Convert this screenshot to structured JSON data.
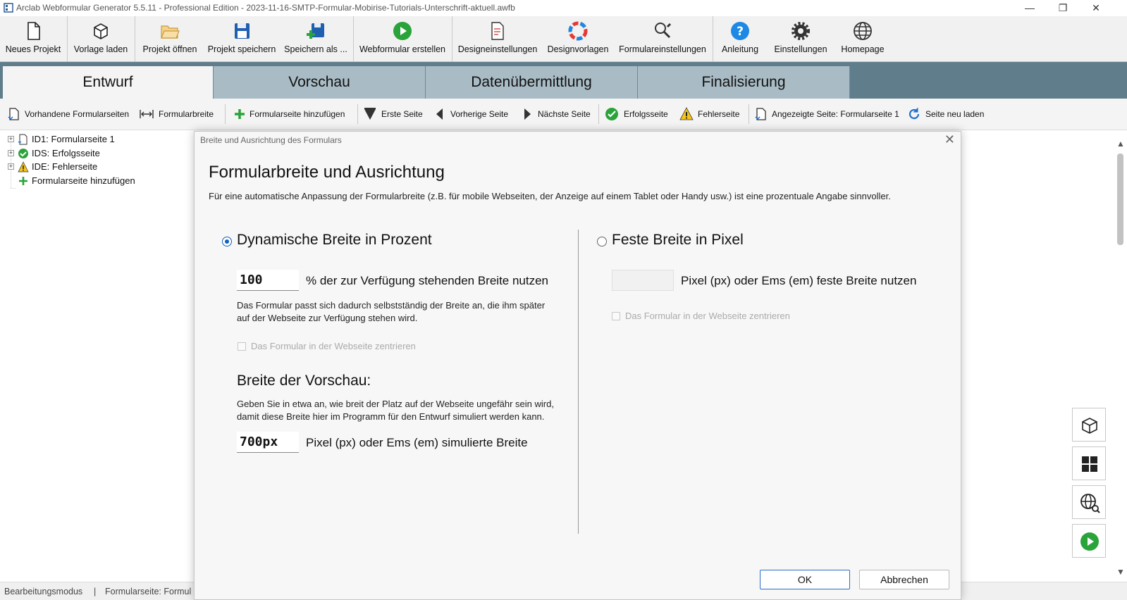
{
  "window": {
    "title": "Arclab Webformular Generator 5.5.11 - Professional Edition - 2023-11-16-SMTP-Formular-Mobirise-Tutorials-Unterschrift-aktuell.awfb",
    "minimize": "—",
    "restore": "❐",
    "close": "✕"
  },
  "toolbar": {
    "items": [
      {
        "label": "Neues Projekt",
        "icon": "new-document-icon"
      },
      {
        "label": "Vorlage laden",
        "icon": "template-box-icon"
      },
      {
        "label": "Projekt öffnen",
        "icon": "folder-open-icon"
      },
      {
        "label": "Projekt speichern",
        "icon": "floppy-disk-icon"
      },
      {
        "label": "Speichern als ...",
        "icon": "save-as-icon"
      },
      {
        "label": "Webformular erstellen",
        "icon": "play-green-icon"
      },
      {
        "label": "Designeinstellungen",
        "icon": "design-document-icon"
      },
      {
        "label": "Designvorlagen",
        "icon": "color-wheel-icon"
      },
      {
        "label": "Formulareinstellungen",
        "icon": "tools-wrench-icon"
      },
      {
        "label": "Anleitung",
        "icon": "help-icon"
      },
      {
        "label": "Einstellungen",
        "icon": "gear-icon"
      },
      {
        "label": "Homepage",
        "icon": "globe-icon"
      }
    ]
  },
  "tabs": [
    {
      "label": "Entwurf",
      "active": true
    },
    {
      "label": "Vorschau",
      "active": false
    },
    {
      "label": "Datenübermittlung",
      "active": false
    },
    {
      "label": "Finalisierung",
      "active": false
    }
  ],
  "subtoolbar": {
    "items": [
      {
        "label": "Vorhandene Formularseiten",
        "icon": "pages-icon"
      },
      {
        "label": "Formularbreite",
        "icon": "width-arrows-icon"
      },
      {
        "label": "Formularseite hinzufügen",
        "icon": "plus-icon"
      },
      {
        "label": "Erste Seite",
        "icon": "first-page-icon"
      },
      {
        "label": "Vorherige Seite",
        "icon": "previous-page-icon"
      },
      {
        "label": "Nächste Seite",
        "icon": "next-page-icon"
      },
      {
        "label": "Erfolgsseite",
        "icon": "success-check-icon"
      },
      {
        "label": "Fehlerseite",
        "icon": "warning-icon"
      },
      {
        "label": "Angezeigte Seite: Formularseite 1",
        "icon": "current-page-icon"
      },
      {
        "label": "Seite neu laden",
        "icon": "reload-icon"
      }
    ]
  },
  "tree": {
    "items": [
      {
        "label": "ID1: Formularseite 1",
        "expander": "+"
      },
      {
        "label": "IDS: Erfolgsseite",
        "expander": "+"
      },
      {
        "label": "IDE: Fehlerseite",
        "expander": "+"
      },
      {
        "label": "Formularseite hinzufügen",
        "expander": ""
      }
    ]
  },
  "statusbar": {
    "mode": "Bearbeitungsmodus",
    "separator": "|",
    "page": "Formularseite: Formul"
  },
  "dialog": {
    "title": "Breite und Ausrichtung des Formulars",
    "close": "✕",
    "heading": "Formularbreite und Ausrichtung",
    "intro": "Für eine automatische Anpassung der Formularbreite (z.B. für mobile Webseiten, der Anzeige auf einem Tablet oder Handy usw.) ist eine prozentuale Angabe sinnvoller.",
    "dynamic": {
      "label": "Dynamische Breite in Prozent",
      "selected": true,
      "value": "100",
      "unit_text": "% der zur Verfügung stehenden Breite nutzen",
      "note_line1": "Das Formular passt sich dadurch selbstständig der Breite an, die ihm später",
      "note_line2": "auf der Webseite zur Verfügung stehen wird.",
      "center_label": "Das Formular in der Webseite zentrieren"
    },
    "preview": {
      "heading": "Breite der Vorschau:",
      "note_line1": "Geben Sie in etwa an, wie breit der Platz auf der Webseite ungefähr sein wird,",
      "note_line2": "damit diese Breite hier im Programm für den Entwurf simuliert werden kann.",
      "value": "700px",
      "unit_text": "Pixel (px) oder Ems (em) simulierte Breite"
    },
    "fixed": {
      "label": "Feste Breite in Pixel",
      "selected": false,
      "value": "",
      "unit_text": "Pixel (px) oder Ems (em) feste Breite nutzen",
      "center_label": "Das Formular in der Webseite zentrieren"
    },
    "ok_label": "OK",
    "cancel_label": "Abbrechen"
  },
  "colors": {
    "tab_band": "#5f7d8a",
    "tab_inactive": "#a9bcc5",
    "accent": "#1060c0",
    "green": "#2aa33a"
  }
}
